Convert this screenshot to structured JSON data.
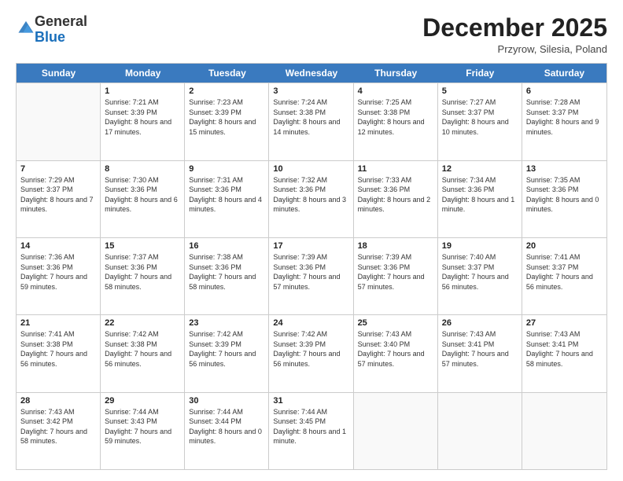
{
  "logo": {
    "general": "General",
    "blue": "Blue"
  },
  "header": {
    "month": "December 2025",
    "location": "Przyrow, Silesia, Poland"
  },
  "days": [
    "Sunday",
    "Monday",
    "Tuesday",
    "Wednesday",
    "Thursday",
    "Friday",
    "Saturday"
  ],
  "weeks": [
    [
      {
        "day": "",
        "sunrise": "",
        "sunset": "",
        "daylight": "",
        "empty": true
      },
      {
        "day": "1",
        "sunrise": "Sunrise: 7:21 AM",
        "sunset": "Sunset: 3:39 PM",
        "daylight": "Daylight: 8 hours and 17 minutes."
      },
      {
        "day": "2",
        "sunrise": "Sunrise: 7:23 AM",
        "sunset": "Sunset: 3:39 PM",
        "daylight": "Daylight: 8 hours and 15 minutes."
      },
      {
        "day": "3",
        "sunrise": "Sunrise: 7:24 AM",
        "sunset": "Sunset: 3:38 PM",
        "daylight": "Daylight: 8 hours and 14 minutes."
      },
      {
        "day": "4",
        "sunrise": "Sunrise: 7:25 AM",
        "sunset": "Sunset: 3:38 PM",
        "daylight": "Daylight: 8 hours and 12 minutes."
      },
      {
        "day": "5",
        "sunrise": "Sunrise: 7:27 AM",
        "sunset": "Sunset: 3:37 PM",
        "daylight": "Daylight: 8 hours and 10 minutes."
      },
      {
        "day": "6",
        "sunrise": "Sunrise: 7:28 AM",
        "sunset": "Sunset: 3:37 PM",
        "daylight": "Daylight: 8 hours and 9 minutes."
      }
    ],
    [
      {
        "day": "7",
        "sunrise": "Sunrise: 7:29 AM",
        "sunset": "Sunset: 3:37 PM",
        "daylight": "Daylight: 8 hours and 7 minutes."
      },
      {
        "day": "8",
        "sunrise": "Sunrise: 7:30 AM",
        "sunset": "Sunset: 3:36 PM",
        "daylight": "Daylight: 8 hours and 6 minutes."
      },
      {
        "day": "9",
        "sunrise": "Sunrise: 7:31 AM",
        "sunset": "Sunset: 3:36 PM",
        "daylight": "Daylight: 8 hours and 4 minutes."
      },
      {
        "day": "10",
        "sunrise": "Sunrise: 7:32 AM",
        "sunset": "Sunset: 3:36 PM",
        "daylight": "Daylight: 8 hours and 3 minutes."
      },
      {
        "day": "11",
        "sunrise": "Sunrise: 7:33 AM",
        "sunset": "Sunset: 3:36 PM",
        "daylight": "Daylight: 8 hours and 2 minutes."
      },
      {
        "day": "12",
        "sunrise": "Sunrise: 7:34 AM",
        "sunset": "Sunset: 3:36 PM",
        "daylight": "Daylight: 8 hours and 1 minute."
      },
      {
        "day": "13",
        "sunrise": "Sunrise: 7:35 AM",
        "sunset": "Sunset: 3:36 PM",
        "daylight": "Daylight: 8 hours and 0 minutes."
      }
    ],
    [
      {
        "day": "14",
        "sunrise": "Sunrise: 7:36 AM",
        "sunset": "Sunset: 3:36 PM",
        "daylight": "Daylight: 7 hours and 59 minutes."
      },
      {
        "day": "15",
        "sunrise": "Sunrise: 7:37 AM",
        "sunset": "Sunset: 3:36 PM",
        "daylight": "Daylight: 7 hours and 58 minutes."
      },
      {
        "day": "16",
        "sunrise": "Sunrise: 7:38 AM",
        "sunset": "Sunset: 3:36 PM",
        "daylight": "Daylight: 7 hours and 58 minutes."
      },
      {
        "day": "17",
        "sunrise": "Sunrise: 7:39 AM",
        "sunset": "Sunset: 3:36 PM",
        "daylight": "Daylight: 7 hours and 57 minutes."
      },
      {
        "day": "18",
        "sunrise": "Sunrise: 7:39 AM",
        "sunset": "Sunset: 3:36 PM",
        "daylight": "Daylight: 7 hours and 57 minutes."
      },
      {
        "day": "19",
        "sunrise": "Sunrise: 7:40 AM",
        "sunset": "Sunset: 3:37 PM",
        "daylight": "Daylight: 7 hours and 56 minutes."
      },
      {
        "day": "20",
        "sunrise": "Sunrise: 7:41 AM",
        "sunset": "Sunset: 3:37 PM",
        "daylight": "Daylight: 7 hours and 56 minutes."
      }
    ],
    [
      {
        "day": "21",
        "sunrise": "Sunrise: 7:41 AM",
        "sunset": "Sunset: 3:38 PM",
        "daylight": "Daylight: 7 hours and 56 minutes."
      },
      {
        "day": "22",
        "sunrise": "Sunrise: 7:42 AM",
        "sunset": "Sunset: 3:38 PM",
        "daylight": "Daylight: 7 hours and 56 minutes."
      },
      {
        "day": "23",
        "sunrise": "Sunrise: 7:42 AM",
        "sunset": "Sunset: 3:39 PM",
        "daylight": "Daylight: 7 hours and 56 minutes."
      },
      {
        "day": "24",
        "sunrise": "Sunrise: 7:42 AM",
        "sunset": "Sunset: 3:39 PM",
        "daylight": "Daylight: 7 hours and 56 minutes."
      },
      {
        "day": "25",
        "sunrise": "Sunrise: 7:43 AM",
        "sunset": "Sunset: 3:40 PM",
        "daylight": "Daylight: 7 hours and 57 minutes."
      },
      {
        "day": "26",
        "sunrise": "Sunrise: 7:43 AM",
        "sunset": "Sunset: 3:41 PM",
        "daylight": "Daylight: 7 hours and 57 minutes."
      },
      {
        "day": "27",
        "sunrise": "Sunrise: 7:43 AM",
        "sunset": "Sunset: 3:41 PM",
        "daylight": "Daylight: 7 hours and 58 minutes."
      }
    ],
    [
      {
        "day": "28",
        "sunrise": "Sunrise: 7:43 AM",
        "sunset": "Sunset: 3:42 PM",
        "daylight": "Daylight: 7 hours and 58 minutes."
      },
      {
        "day": "29",
        "sunrise": "Sunrise: 7:44 AM",
        "sunset": "Sunset: 3:43 PM",
        "daylight": "Daylight: 7 hours and 59 minutes."
      },
      {
        "day": "30",
        "sunrise": "Sunrise: 7:44 AM",
        "sunset": "Sunset: 3:44 PM",
        "daylight": "Daylight: 8 hours and 0 minutes."
      },
      {
        "day": "31",
        "sunrise": "Sunrise: 7:44 AM",
        "sunset": "Sunset: 3:45 PM",
        "daylight": "Daylight: 8 hours and 1 minute."
      },
      {
        "day": "",
        "sunrise": "",
        "sunset": "",
        "daylight": "",
        "empty": true
      },
      {
        "day": "",
        "sunrise": "",
        "sunset": "",
        "daylight": "",
        "empty": true
      },
      {
        "day": "",
        "sunrise": "",
        "sunset": "",
        "daylight": "",
        "empty": true
      }
    ]
  ]
}
